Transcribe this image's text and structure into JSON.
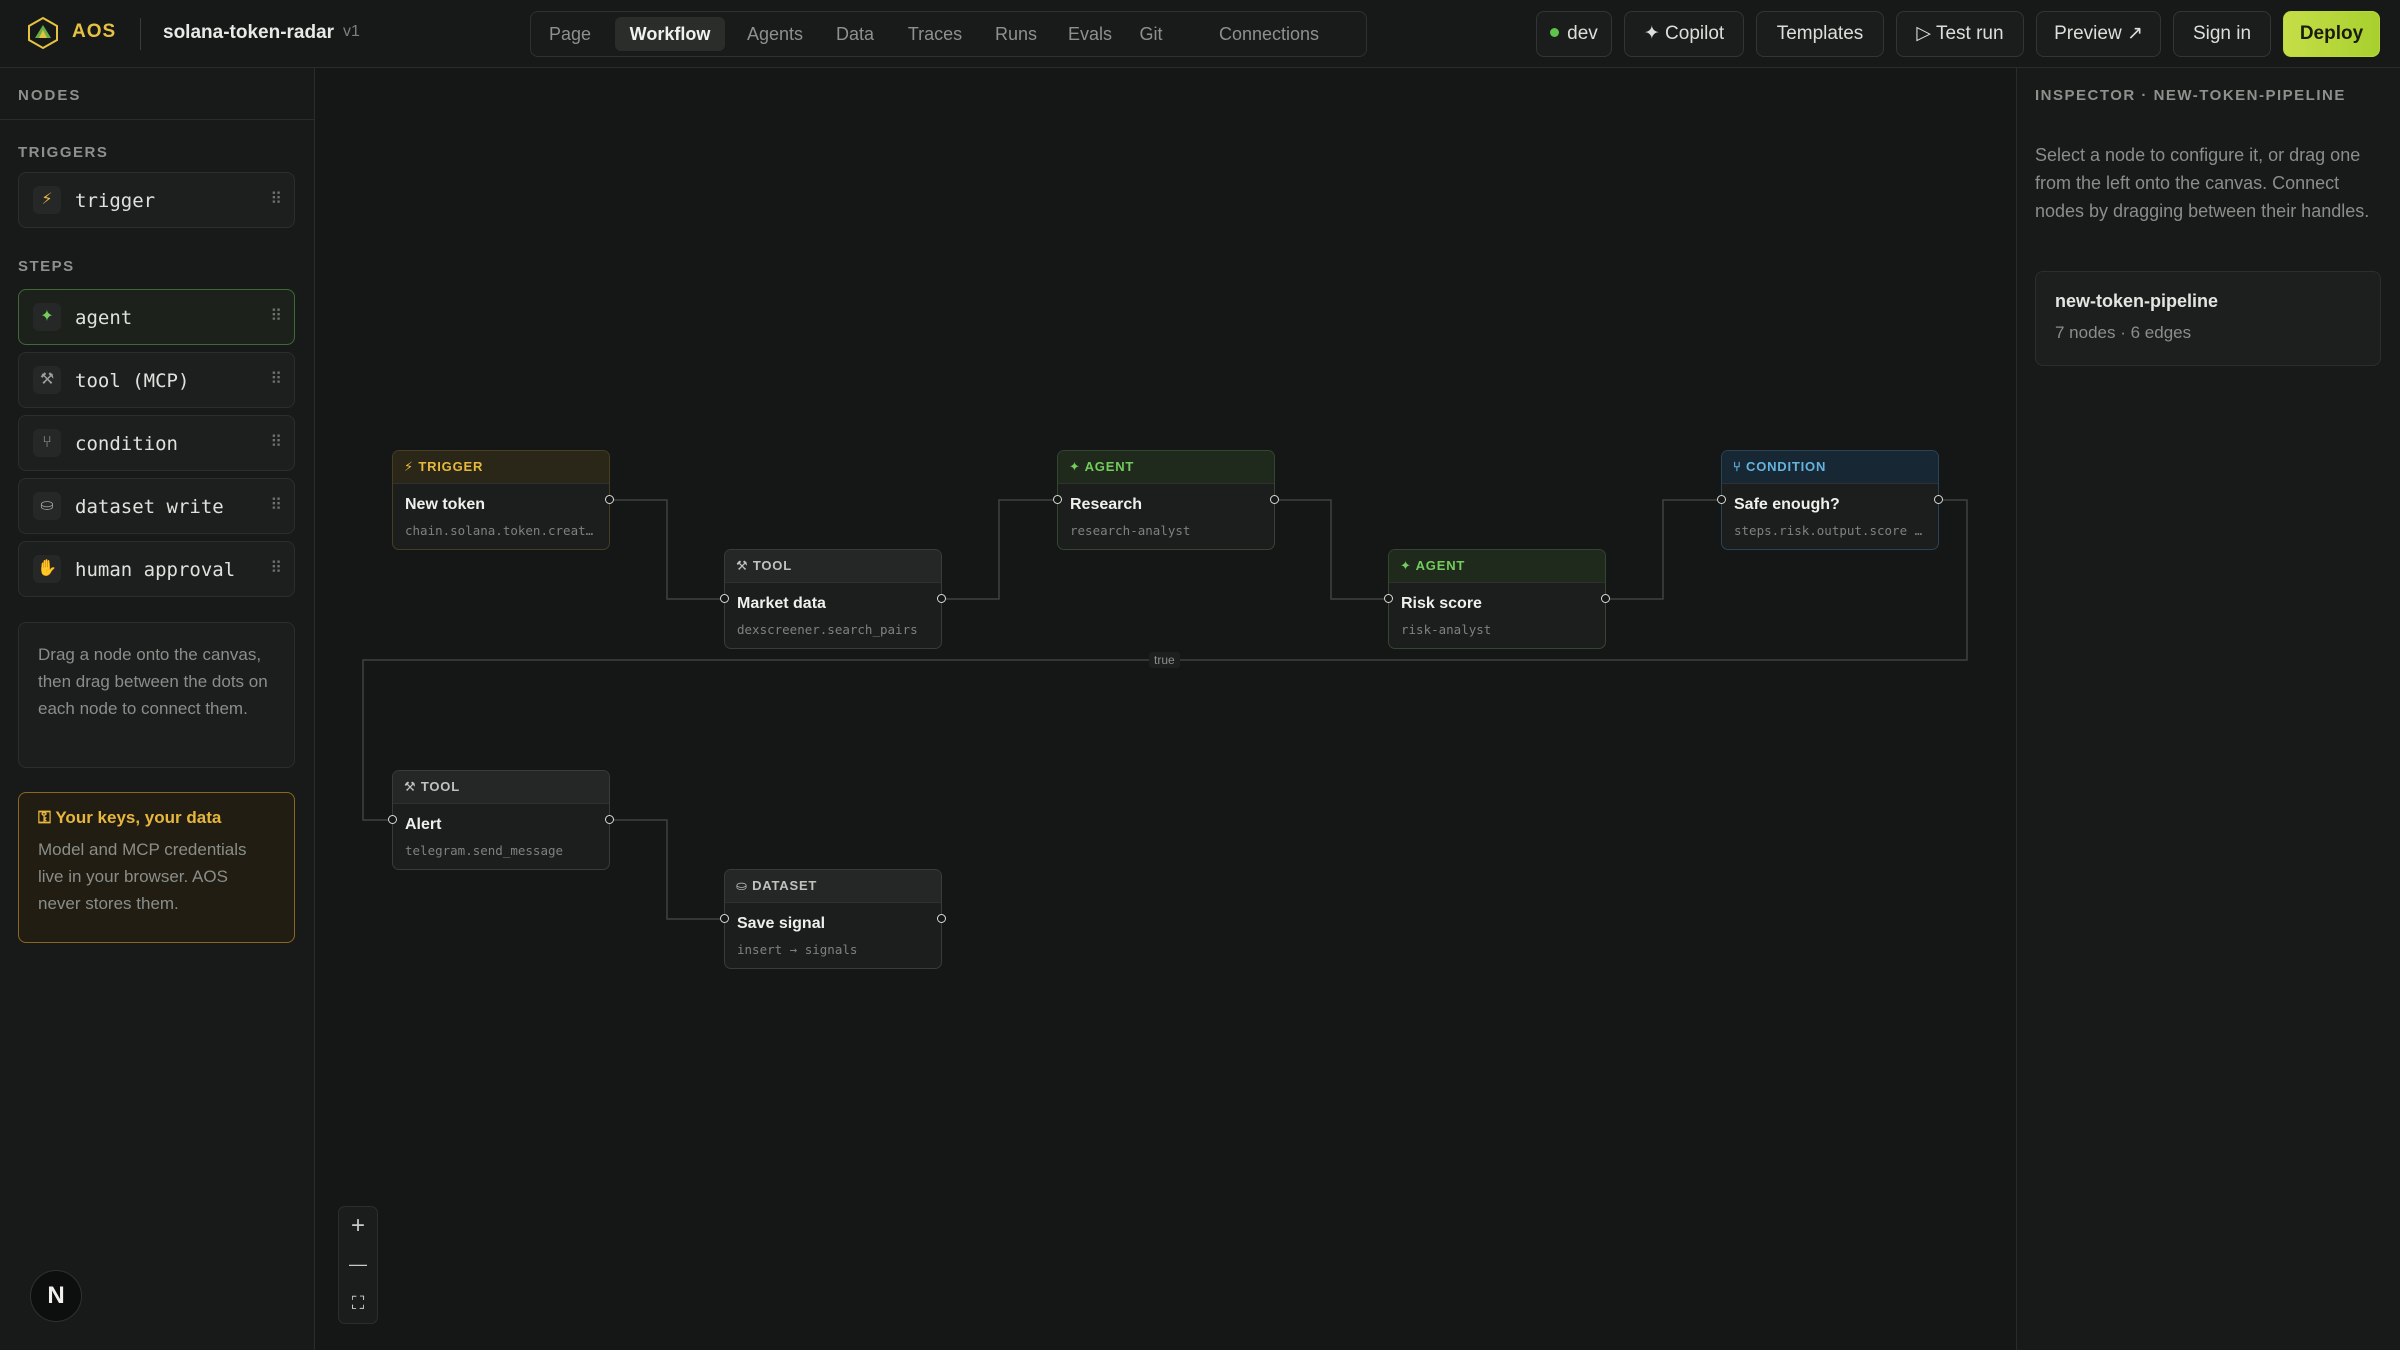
{
  "header": {
    "brand": "AOS",
    "project": "solana-token-radar",
    "version": "v1",
    "tabs": [
      "Page",
      "Workflow",
      "Agents",
      "Data",
      "Traces",
      "Runs",
      "Evals",
      "Git",
      "Connections"
    ],
    "active_tab": "Workflow",
    "env_label": "dev",
    "copilot_label": "✦ Copilot",
    "templates_label": "Templates",
    "test_run_label": "▷ Test run",
    "preview_label": "Preview ↗",
    "sign_in_label": "Sign in",
    "deploy_label": "Deploy"
  },
  "sidebar": {
    "title": "NODES",
    "triggers_label": "TRIGGERS",
    "steps_label": "STEPS",
    "triggers": [
      {
        "label": "trigger",
        "icon": "bolt-icon",
        "glyph": "⚡"
      }
    ],
    "steps": [
      {
        "label": "agent",
        "icon": "sparkle-icon",
        "glyph": "✦"
      },
      {
        "label": "tool (MCP)",
        "icon": "tool-icon",
        "glyph": "⚒"
      },
      {
        "label": "condition",
        "icon": "branch-icon",
        "glyph": "⑂"
      },
      {
        "label": "dataset write",
        "icon": "database-icon",
        "glyph": "⛀"
      },
      {
        "label": "human approval",
        "icon": "hand-icon",
        "glyph": "✋"
      }
    ],
    "help_text": "Drag a node onto the canvas, then drag between the dots on each node to connect them.",
    "keys_title": "Your keys, your data",
    "keys_body": "Model and MCP credentials live in your browser. AOS never stores them.",
    "avatar_letter": "N"
  },
  "canvas": {
    "nodes": [
      {
        "id": "n1",
        "kind": "trigger",
        "tag": "⚡ TRIGGER",
        "title": "New token",
        "subtitle": "chain.solana.token.created"
      },
      {
        "id": "n2",
        "kind": "tool",
        "tag": "⚒ TOOL",
        "title": "Market data",
        "subtitle": "dexscreener.search_pairs"
      },
      {
        "id": "n3",
        "kind": "agent",
        "tag": "✦ AGENT",
        "title": "Research",
        "subtitle": "research-analyst"
      },
      {
        "id": "n4",
        "kind": "agent",
        "tag": "✦ AGENT",
        "title": "Risk score",
        "subtitle": "risk-analyst"
      },
      {
        "id": "n5",
        "kind": "condition",
        "tag": "⑂ CONDITION",
        "title": "Safe enough?",
        "subtitle": "steps.risk.output.score >…"
      },
      {
        "id": "n6",
        "kind": "tool",
        "tag": "⚒ TOOL",
        "title": "Alert",
        "subtitle": "telegram.send_message"
      },
      {
        "id": "n7",
        "kind": "dataset",
        "tag": "⛀ DATASET",
        "title": "Save signal",
        "subtitle": "insert → signals"
      }
    ],
    "edge_label_true": "true",
    "zoom_in": "+",
    "zoom_out": "—",
    "fit": "⛶"
  },
  "inspector": {
    "title": "INSPECTOR · NEW-TOKEN-PIPELINE",
    "description": "Select a node to configure it, or drag one from the left onto the canvas. Connect nodes by dragging between their handles.",
    "pipeline_name": "new-token-pipeline",
    "pipeline_stats": "7 nodes · 6 edges"
  },
  "colors": {
    "accent": "#c6de48",
    "trigger": "#e6b83b",
    "agent": "#73cc5c",
    "condition": "#62b4df"
  }
}
